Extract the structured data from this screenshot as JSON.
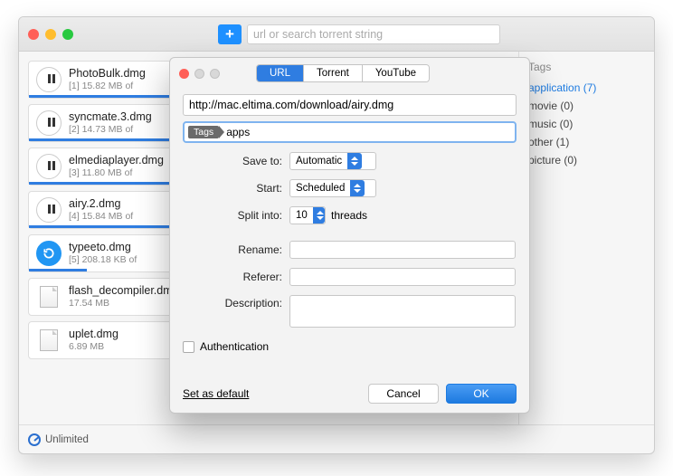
{
  "header": {
    "search_placeholder": "url or search torrent string"
  },
  "downloads": [
    {
      "name": "PhotoBulk.dmg",
      "idx": "[1]",
      "size": "15.82 MB of",
      "progress": 58,
      "state": "pause"
    },
    {
      "name": "syncmate.3.dmg",
      "idx": "[2]",
      "size": "14.73 MB of",
      "progress": 62,
      "state": "pause"
    },
    {
      "name": "elmediaplayer.dmg",
      "idx": "[3]",
      "size": "11.80 MB of",
      "progress": 48,
      "state": "pause"
    },
    {
      "name": "airy.2.dmg",
      "idx": "[4]",
      "size": "15.84 MB of",
      "progress": 70,
      "state": "pause"
    },
    {
      "name": "typeeto.dmg",
      "idx": "[5]",
      "size": "208.18 KB of",
      "progress": 12,
      "state": "spin"
    },
    {
      "name": "flash_decompiler.dmg",
      "idx": "",
      "size": "17.54 MB",
      "progress": 0,
      "state": "file"
    },
    {
      "name": "uplet.dmg",
      "idx": "",
      "size": "6.89 MB",
      "progress": 0,
      "state": "file"
    }
  ],
  "sidebar": {
    "header": "Tags",
    "items": [
      {
        "label": "application (7)",
        "cls": "blue"
      },
      {
        "label": "movie (0)",
        "cls": ""
      },
      {
        "label": "music (0)",
        "cls": ""
      },
      {
        "label": "other (1)",
        "cls": ""
      },
      {
        "label": "picture (0)",
        "cls": ""
      }
    ]
  },
  "footer": {
    "status": "Unlimited"
  },
  "dialog": {
    "tabs": {
      "url": "URL",
      "torrent": "Torrent",
      "youtube": "YouTube"
    },
    "url_value": "http://mac.eltima.com/download/airy.dmg",
    "tag_chip": "Tags",
    "tag_text": "apps",
    "saveto_label": "Save to:",
    "saveto_value": "Automatic",
    "start_label": "Start:",
    "start_value": "Scheduled",
    "split_label": "Split into:",
    "split_value": "10",
    "split_suffix": "threads",
    "rename_label": "Rename:",
    "referer_label": "Referer:",
    "description_label": "Description:",
    "auth_label": "Authentication",
    "set_default": "Set as default",
    "cancel": "Cancel",
    "ok": "OK"
  }
}
